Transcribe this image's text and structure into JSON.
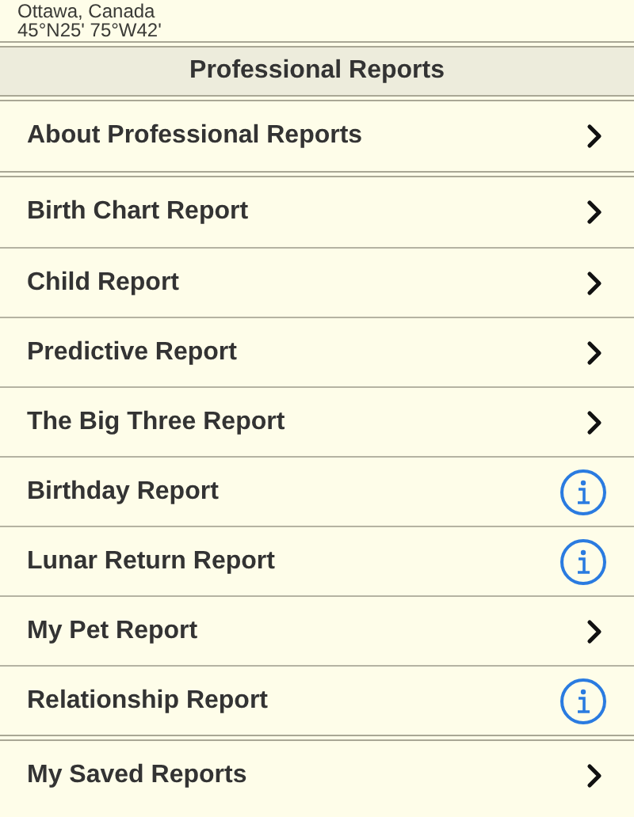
{
  "location": {
    "place": "Ottawa, Canada",
    "coordinates": "45°N25' 75°W42'"
  },
  "section_header": "Professional Reports",
  "groups": [
    {
      "rows": [
        {
          "label": "About Professional Reports",
          "kind": "chevron"
        }
      ]
    },
    {
      "rows": [
        {
          "label": "Birth Chart Report",
          "kind": "chevron"
        },
        {
          "label": "Child Report",
          "kind": "chevron"
        },
        {
          "label": "Predictive Report",
          "kind": "chevron"
        },
        {
          "label": "The Big Three Report",
          "kind": "chevron"
        },
        {
          "label": "Birthday Report",
          "kind": "info"
        },
        {
          "label": "Lunar Return Report",
          "kind": "info"
        },
        {
          "label": "My Pet Report",
          "kind": "chevron"
        },
        {
          "label": "Relationship Report",
          "kind": "info"
        }
      ]
    },
    {
      "rows": [
        {
          "label": "My Saved Reports",
          "kind": "chevron"
        }
      ]
    }
  ]
}
